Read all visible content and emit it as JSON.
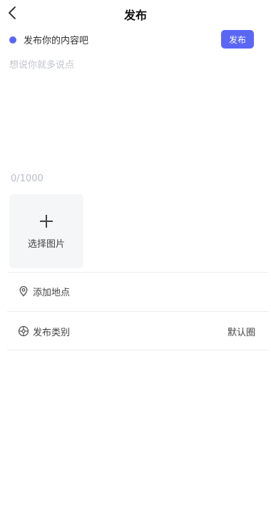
{
  "header": {
    "title": "发布",
    "back_icon": "chevron-left-icon"
  },
  "composer": {
    "prompt": "发布你的内容吧",
    "publish_label": "发布",
    "placeholder": "想说你就多说点",
    "counter": "0/1000",
    "accent_color": "#5a67f5"
  },
  "image_picker": {
    "label": "选择图片",
    "icon": "plus-icon"
  },
  "options": {
    "location": {
      "label": "添加地点",
      "icon": "location-pin-icon"
    },
    "category": {
      "label": "发布类别",
      "value": "默认圈",
      "icon": "category-icon"
    }
  }
}
